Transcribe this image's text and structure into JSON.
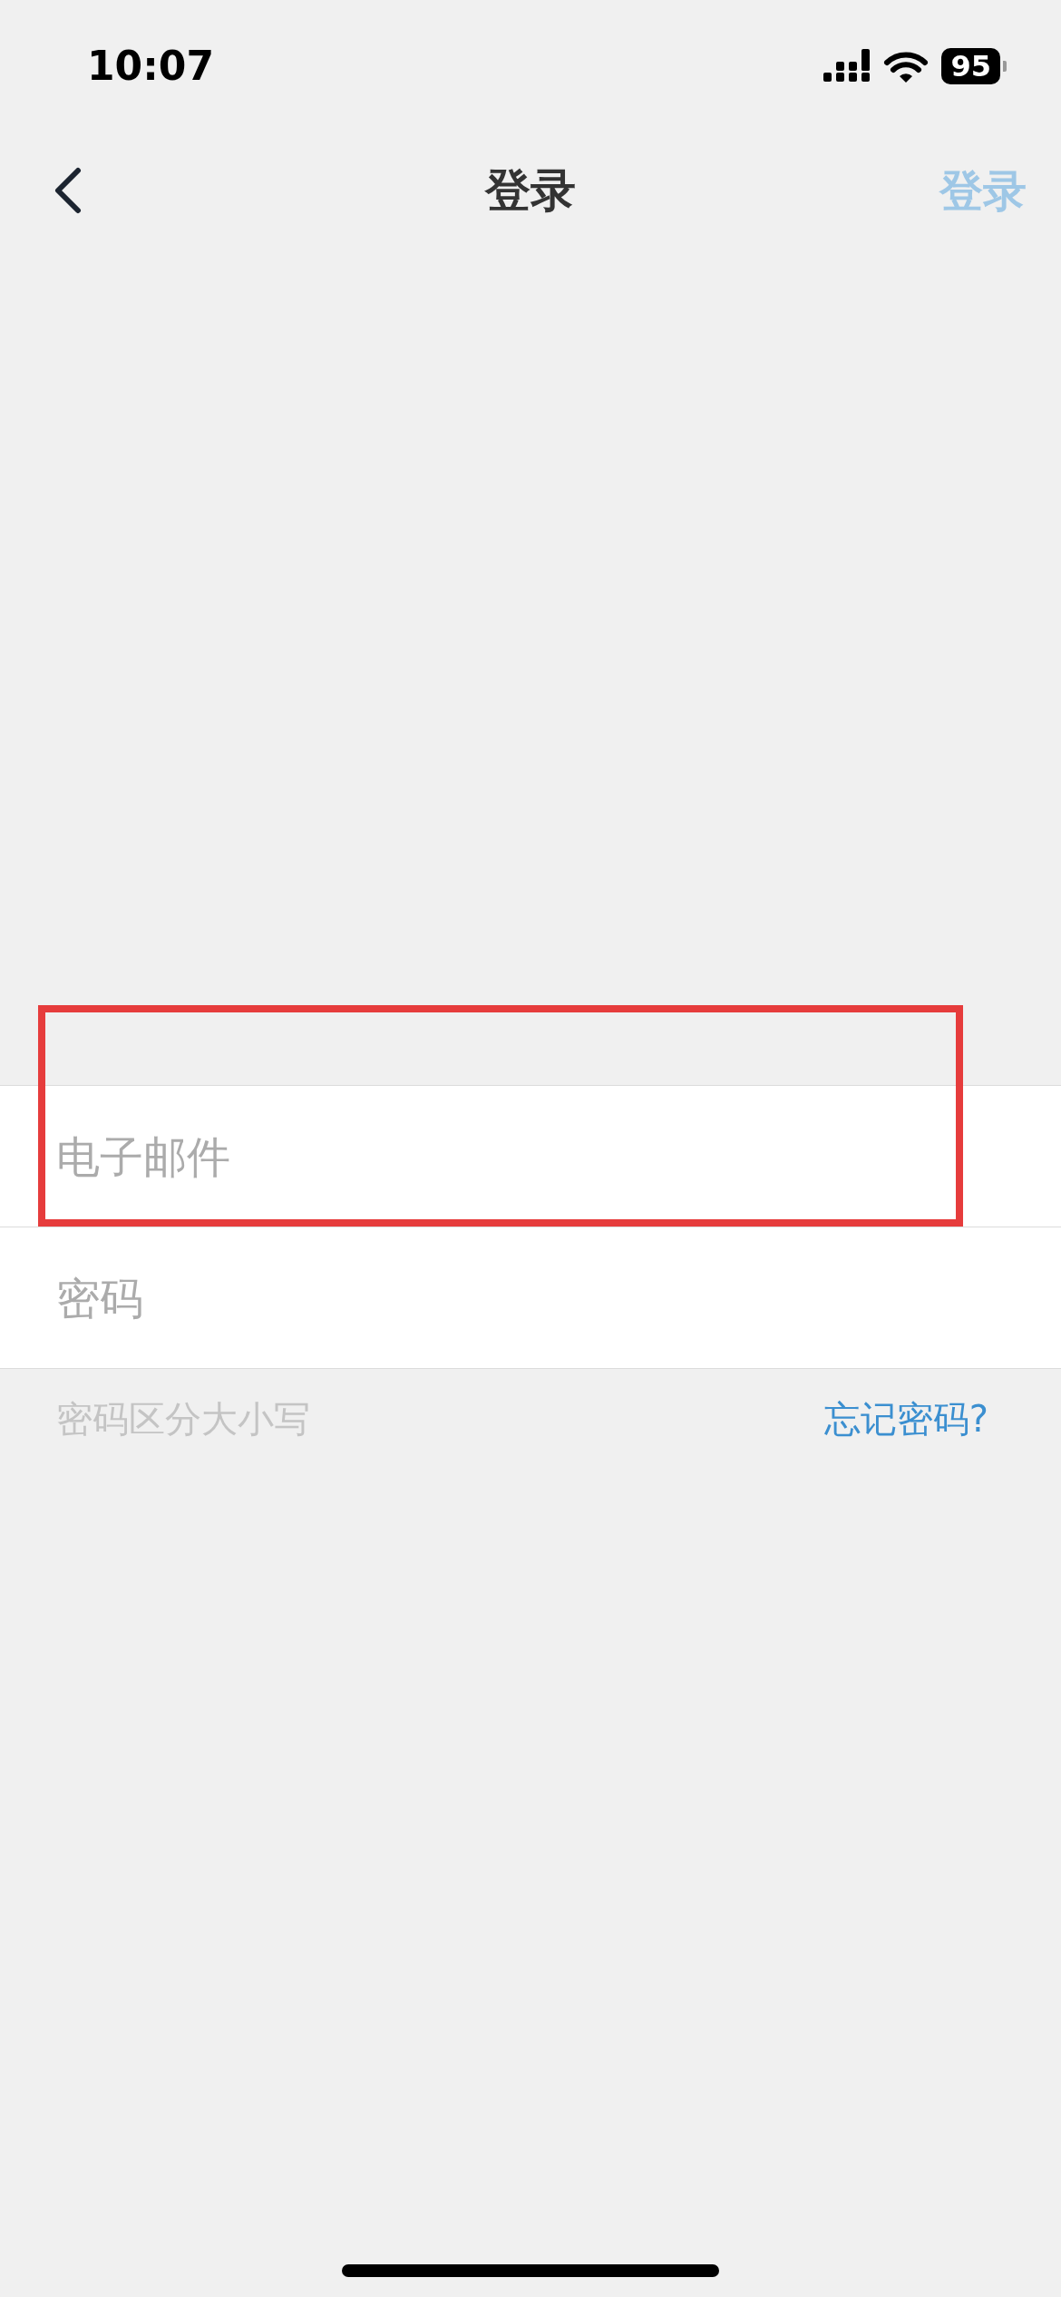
{
  "status_bar": {
    "time": "10:07",
    "battery": "95"
  },
  "nav": {
    "title": "登录",
    "action": "登录",
    "action_disabled": true
  },
  "fields": [
    {
      "placeholder": "电子邮件",
      "highlighted": true
    },
    {
      "placeholder": "密码",
      "highlighted": false
    }
  ],
  "hint": "密码区分大小写",
  "forgot_link": "忘记密码?"
}
